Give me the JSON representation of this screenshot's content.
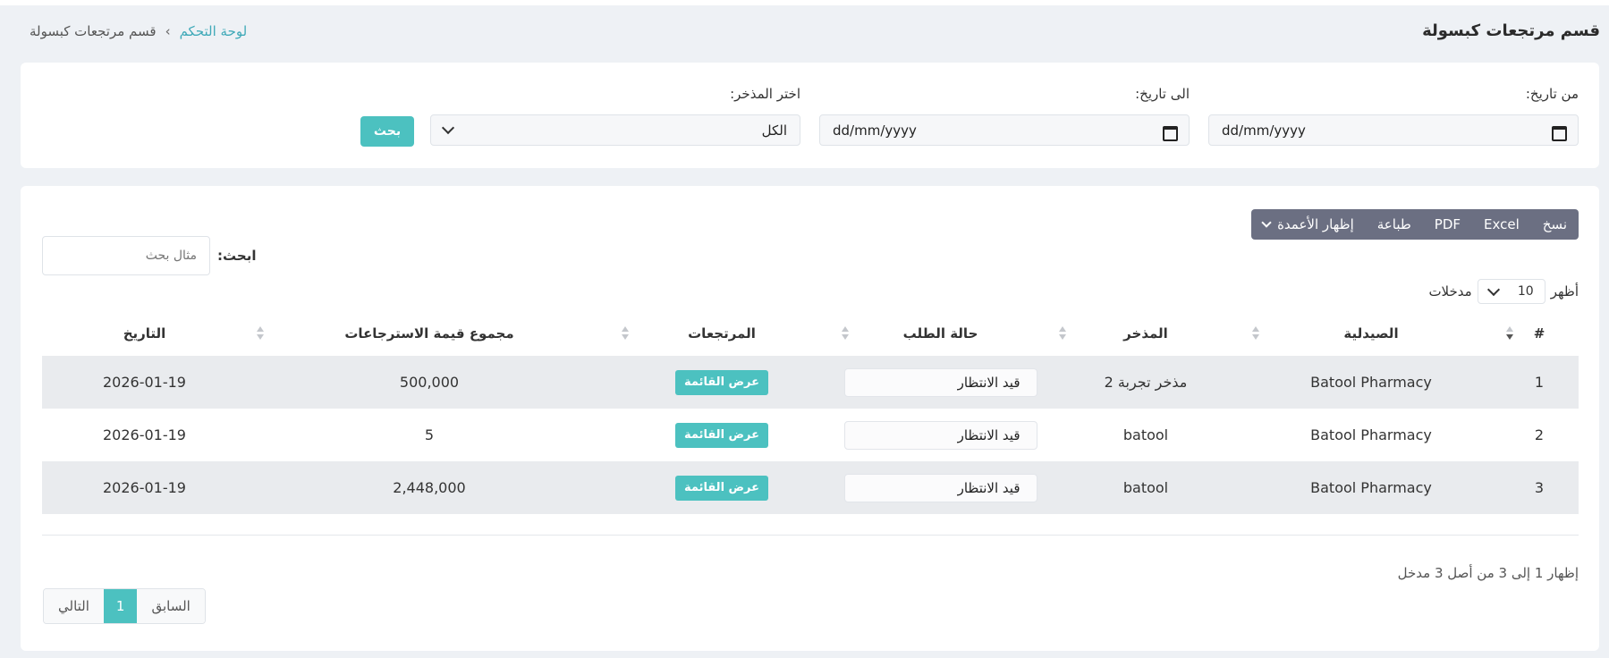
{
  "header": {
    "title": "قسم مرتجعات كبسولة",
    "breadcrumb": {
      "home": "لوحة التحكم",
      "current": "قسم مرتجعات كبسولة"
    }
  },
  "filters": {
    "from_label": "من تاريخ:",
    "from_value": "dd/mm/yyyy",
    "to_label": "الى تاريخ:",
    "to_value": "dd/mm/yyyy",
    "store_label": "اختر المذخر:",
    "store_value": "الكل",
    "search_button": "بحث"
  },
  "toolbar": {
    "buttons": [
      "نسخ",
      "Excel",
      "PDF",
      "طباعة",
      "إظهار الأعمدة"
    ]
  },
  "search": {
    "label": "ابحث:",
    "placeholder": "مثال بحث"
  },
  "length": {
    "prefix": "أظهر",
    "value": "10",
    "suffix": "مدخلات"
  },
  "table": {
    "columns": [
      "#",
      "الصيدلية",
      "المذخر",
      "حالة الطلب",
      "المرتجعات",
      "مجموع قيمة الاسترجاعات",
      "التاريخ"
    ],
    "rows": [
      {
        "num": "1",
        "pharmacy": "Batool Pharmacy",
        "store": "مذخر تجربة 2",
        "status": "قيد الانتظار",
        "returns": "عرض القائمة",
        "total": "500,000",
        "date": "2026-01-19"
      },
      {
        "num": "2",
        "pharmacy": "Batool Pharmacy",
        "store": "batool",
        "status": "قيد الانتظار",
        "returns": "عرض القائمة",
        "total": "5",
        "date": "2026-01-19"
      },
      {
        "num": "3",
        "pharmacy": "Batool Pharmacy",
        "store": "batool",
        "status": "قيد الانتظار",
        "returns": "عرض القائمة",
        "total": "2,448,000",
        "date": "2026-01-19"
      }
    ]
  },
  "footer": {
    "info": "إظهار 1 إلى 3 من أصل 3 مدخل",
    "pager": {
      "prev": "السابق",
      "current": "1",
      "next": "التالي"
    }
  },
  "colors": {
    "accent": "#4cc1c0",
    "link": "#3fa9b8",
    "toolbar": "#6b6f82"
  }
}
